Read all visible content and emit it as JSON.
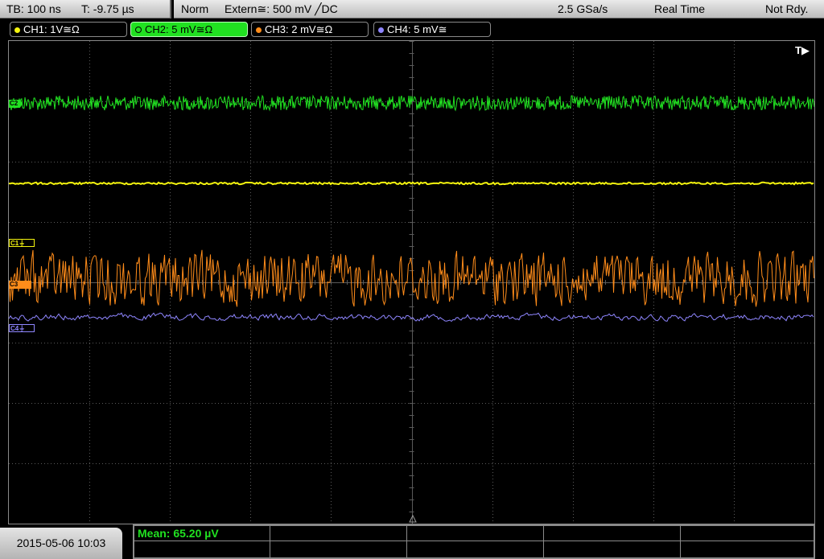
{
  "topbar": {
    "timebase": "TB: 100 ns",
    "trigger_time": "T: -9.75 µs",
    "mode": "Norm",
    "trigger_source": "Extern≅: 500 mV ╱DC",
    "sample_rate": "2.5 GSa/s",
    "acq_mode": "Real Time",
    "status": "Not Rdy."
  },
  "channels": [
    {
      "label": "CH1: 1V≅Ω",
      "color": "#f5f50f",
      "active": false
    },
    {
      "label": "CH2: 5 mV≅Ω",
      "color": "#21e121",
      "active": true
    },
    {
      "label": "CH3: 2 mV≅Ω",
      "color": "#ff8c1a",
      "active": false
    },
    {
      "label": "CH4: 5 mV≅",
      "color": "#8f86ff",
      "active": false
    }
  ],
  "screen": {
    "trigger_indicator": "T▶",
    "markers": {
      "ch2": "C2",
      "ch1": "C1⏚",
      "ch3": "C3",
      "ch4": "C4⏚"
    }
  },
  "bottom": {
    "datetime": "2015-05-06 10:03",
    "measurement": "Mean: 65.20 µV"
  },
  "colors": {
    "ch1": "#f5f50f",
    "ch2": "#21e121",
    "ch3": "#ff8c1a",
    "ch4": "#8f86ff",
    "grid": "#5a5a5a"
  }
}
